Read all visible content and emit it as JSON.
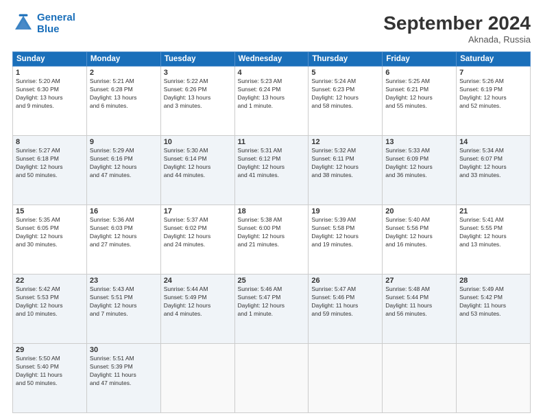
{
  "logo": {
    "line1": "General",
    "line2": "Blue"
  },
  "header": {
    "month": "September 2024",
    "location": "Aknada, Russia"
  },
  "weekdays": [
    "Sunday",
    "Monday",
    "Tuesday",
    "Wednesday",
    "Thursday",
    "Friday",
    "Saturday"
  ],
  "weeks": [
    [
      {
        "day": 1,
        "info": "Sunrise: 5:20 AM\nSunset: 6:30 PM\nDaylight: 13 hours\nand 9 minutes."
      },
      {
        "day": 2,
        "info": "Sunrise: 5:21 AM\nSunset: 6:28 PM\nDaylight: 13 hours\nand 6 minutes."
      },
      {
        "day": 3,
        "info": "Sunrise: 5:22 AM\nSunset: 6:26 PM\nDaylight: 13 hours\nand 3 minutes."
      },
      {
        "day": 4,
        "info": "Sunrise: 5:23 AM\nSunset: 6:24 PM\nDaylight: 13 hours\nand 1 minute."
      },
      {
        "day": 5,
        "info": "Sunrise: 5:24 AM\nSunset: 6:23 PM\nDaylight: 12 hours\nand 58 minutes."
      },
      {
        "day": 6,
        "info": "Sunrise: 5:25 AM\nSunset: 6:21 PM\nDaylight: 12 hours\nand 55 minutes."
      },
      {
        "day": 7,
        "info": "Sunrise: 5:26 AM\nSunset: 6:19 PM\nDaylight: 12 hours\nand 52 minutes."
      }
    ],
    [
      {
        "day": 8,
        "info": "Sunrise: 5:27 AM\nSunset: 6:18 PM\nDaylight: 12 hours\nand 50 minutes."
      },
      {
        "day": 9,
        "info": "Sunrise: 5:29 AM\nSunset: 6:16 PM\nDaylight: 12 hours\nand 47 minutes."
      },
      {
        "day": 10,
        "info": "Sunrise: 5:30 AM\nSunset: 6:14 PM\nDaylight: 12 hours\nand 44 minutes."
      },
      {
        "day": 11,
        "info": "Sunrise: 5:31 AM\nSunset: 6:12 PM\nDaylight: 12 hours\nand 41 minutes."
      },
      {
        "day": 12,
        "info": "Sunrise: 5:32 AM\nSunset: 6:11 PM\nDaylight: 12 hours\nand 38 minutes."
      },
      {
        "day": 13,
        "info": "Sunrise: 5:33 AM\nSunset: 6:09 PM\nDaylight: 12 hours\nand 36 minutes."
      },
      {
        "day": 14,
        "info": "Sunrise: 5:34 AM\nSunset: 6:07 PM\nDaylight: 12 hours\nand 33 minutes."
      }
    ],
    [
      {
        "day": 15,
        "info": "Sunrise: 5:35 AM\nSunset: 6:05 PM\nDaylight: 12 hours\nand 30 minutes."
      },
      {
        "day": 16,
        "info": "Sunrise: 5:36 AM\nSunset: 6:03 PM\nDaylight: 12 hours\nand 27 minutes."
      },
      {
        "day": 17,
        "info": "Sunrise: 5:37 AM\nSunset: 6:02 PM\nDaylight: 12 hours\nand 24 minutes."
      },
      {
        "day": 18,
        "info": "Sunrise: 5:38 AM\nSunset: 6:00 PM\nDaylight: 12 hours\nand 21 minutes."
      },
      {
        "day": 19,
        "info": "Sunrise: 5:39 AM\nSunset: 5:58 PM\nDaylight: 12 hours\nand 19 minutes."
      },
      {
        "day": 20,
        "info": "Sunrise: 5:40 AM\nSunset: 5:56 PM\nDaylight: 12 hours\nand 16 minutes."
      },
      {
        "day": 21,
        "info": "Sunrise: 5:41 AM\nSunset: 5:55 PM\nDaylight: 12 hours\nand 13 minutes."
      }
    ],
    [
      {
        "day": 22,
        "info": "Sunrise: 5:42 AM\nSunset: 5:53 PM\nDaylight: 12 hours\nand 10 minutes."
      },
      {
        "day": 23,
        "info": "Sunrise: 5:43 AM\nSunset: 5:51 PM\nDaylight: 12 hours\nand 7 minutes."
      },
      {
        "day": 24,
        "info": "Sunrise: 5:44 AM\nSunset: 5:49 PM\nDaylight: 12 hours\nand 4 minutes."
      },
      {
        "day": 25,
        "info": "Sunrise: 5:46 AM\nSunset: 5:47 PM\nDaylight: 12 hours\nand 1 minute."
      },
      {
        "day": 26,
        "info": "Sunrise: 5:47 AM\nSunset: 5:46 PM\nDaylight: 11 hours\nand 59 minutes."
      },
      {
        "day": 27,
        "info": "Sunrise: 5:48 AM\nSunset: 5:44 PM\nDaylight: 11 hours\nand 56 minutes."
      },
      {
        "day": 28,
        "info": "Sunrise: 5:49 AM\nSunset: 5:42 PM\nDaylight: 11 hours\nand 53 minutes."
      }
    ],
    [
      {
        "day": 29,
        "info": "Sunrise: 5:50 AM\nSunset: 5:40 PM\nDaylight: 11 hours\nand 50 minutes."
      },
      {
        "day": 30,
        "info": "Sunrise: 5:51 AM\nSunset: 5:39 PM\nDaylight: 11 hours\nand 47 minutes."
      },
      {
        "day": null
      },
      {
        "day": null
      },
      {
        "day": null
      },
      {
        "day": null
      },
      {
        "day": null
      }
    ]
  ]
}
